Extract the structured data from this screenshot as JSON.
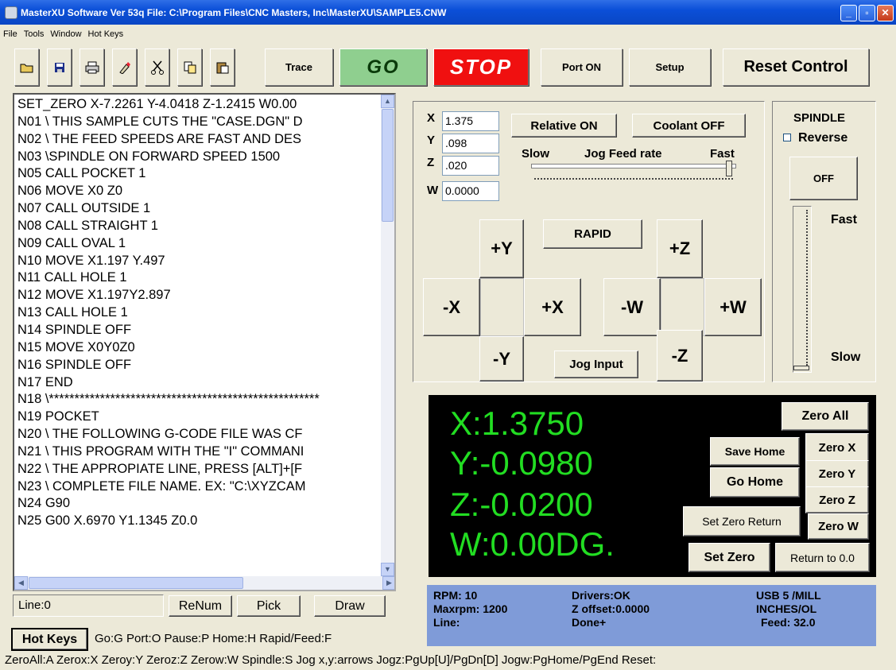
{
  "window": {
    "title": "MasterXU Software Ver 53q File: C:\\Program Files\\CNC Masters, Inc\\MasterXU\\SAMPLE5.CNW",
    "min": "_",
    "max": "▫",
    "close": "✕"
  },
  "menu": [
    "File",
    "Tools",
    "Window",
    "Hot Keys"
  ],
  "toolbar": {
    "icons": [
      "open-folder-icon",
      "save-icon",
      "print-icon",
      "eraser-icon",
      "cut-icon",
      "copy-icon",
      "paste-icon"
    ],
    "trace": "Trace",
    "go": "GO",
    "stop": "STOP",
    "port": "Port ON",
    "setup": "Setup",
    "reset": "Reset Control"
  },
  "code_lines": [
    "SET_ZERO X-7.2261 Y-4.0418 Z-1.2415 W0.00",
    "N01 \\ THIS SAMPLE CUTS THE \"CASE.DGN\" D",
    "N02 \\ THE FEED SPEEDS ARE FAST AND DES",
    "N03 \\SPINDLE ON FORWARD SPEED 1500",
    "N05 CALL POCKET 1",
    "N06 MOVE X0 Z0",
    "N07 CALL OUTSIDE 1",
    "N08 CALL STRAIGHT 1",
    "N09 CALL OVAL 1",
    "N10 MOVE X1.197 Y.497",
    "N11 CALL HOLE 1",
    "N12 MOVE X1.197Y2.897",
    "N13 CALL HOLE 1",
    "N14 SPINDLE OFF",
    "N15 MOVE X0Y0Z0",
    "N16 SPINDLE OFF",
    "N17 END",
    "N18 \\*****************************************************",
    "N19 POCKET",
    "N20 \\ THE FOLLOWING G-CODE FILE WAS CF",
    "N21 \\ THIS PROGRAM WITH THE \"I\" COMMANI",
    "N22 \\ THE APPROPIATE LINE, PRESS [ALT]+[F",
    "N23 \\ COMPLETE FILE NAME. EX: \"C:\\XYZCAM",
    "N24 G90",
    "N25 G00 X.6970 Y1.1345 Z0.0"
  ],
  "editor": {
    "line": "Line:0",
    "renum": "ReNum",
    "pick": "Pick",
    "draw": "Draw"
  },
  "jog": {
    "x_label": "X",
    "x": "1.375",
    "y_label": "Y",
    "y": ".098",
    "z_label": "Z",
    "z": ".020",
    "w_label": "W",
    "w": "0.0000",
    "relative": "Relative ON",
    "coolant": "Coolant OFF",
    "slow": "Slow",
    "feed": "Jog Feed rate",
    "fast": "Fast",
    "rapid": "RAPID",
    "plus_y": "+Y",
    "minus_x": "-X",
    "plus_x": "+X",
    "minus_y": "-Y",
    "plus_z": "+Z",
    "minus_w": "-W",
    "plus_w": "+W",
    "minus_z": "-Z",
    "jog_input": "Jog Input",
    "feed_rate_fraction": 0.98
  },
  "spindle": {
    "title": "SPINDLE",
    "reverse": "Reverse",
    "off": "OFF",
    "fast": "Fast",
    "slow": "Slow",
    "speed_fraction": 0.0
  },
  "dro": {
    "x": "X:1.3750",
    "y": "Y:-0.0980",
    "z": "Z:-0.0200",
    "w": "W:0.00DG.",
    "zero_all": "Zero All",
    "save_home": "Save Home",
    "zero_x": "Zero X",
    "go_home": "Go Home",
    "zero_y": "Zero Y",
    "zero_z": "Zero Z",
    "set_zero_return": "Set Zero Return",
    "zero_w": "Zero W",
    "set_zero": "Set Zero",
    "return": "Return to 0.0"
  },
  "status": {
    "rpm": "RPM: 10",
    "maxrpm": "Maxrpm: 1200",
    "line": "Line:",
    "drivers": "Drivers:OK",
    "zoffset": "Z offset:0.0000",
    "done": "Done+",
    "usb": "USB 5 /MILL",
    "units": "INCHES/OL",
    "feed": "Feed: 32.0"
  },
  "hotkeys": {
    "button": "Hot Keys",
    "line1": "Go:G  Port:O  Pause:P  Home:H  Rapid/Feed:F",
    "line2": "ZeroAll:A  Zerox:X  Zeroy:Y  Zeroz:Z  Zerow:W  Spindle:S  Jog x,y:arrows  Jogz:PgUp[U]/PgDn[D]  Jogw:PgHome/PgEnd  Reset:"
  }
}
